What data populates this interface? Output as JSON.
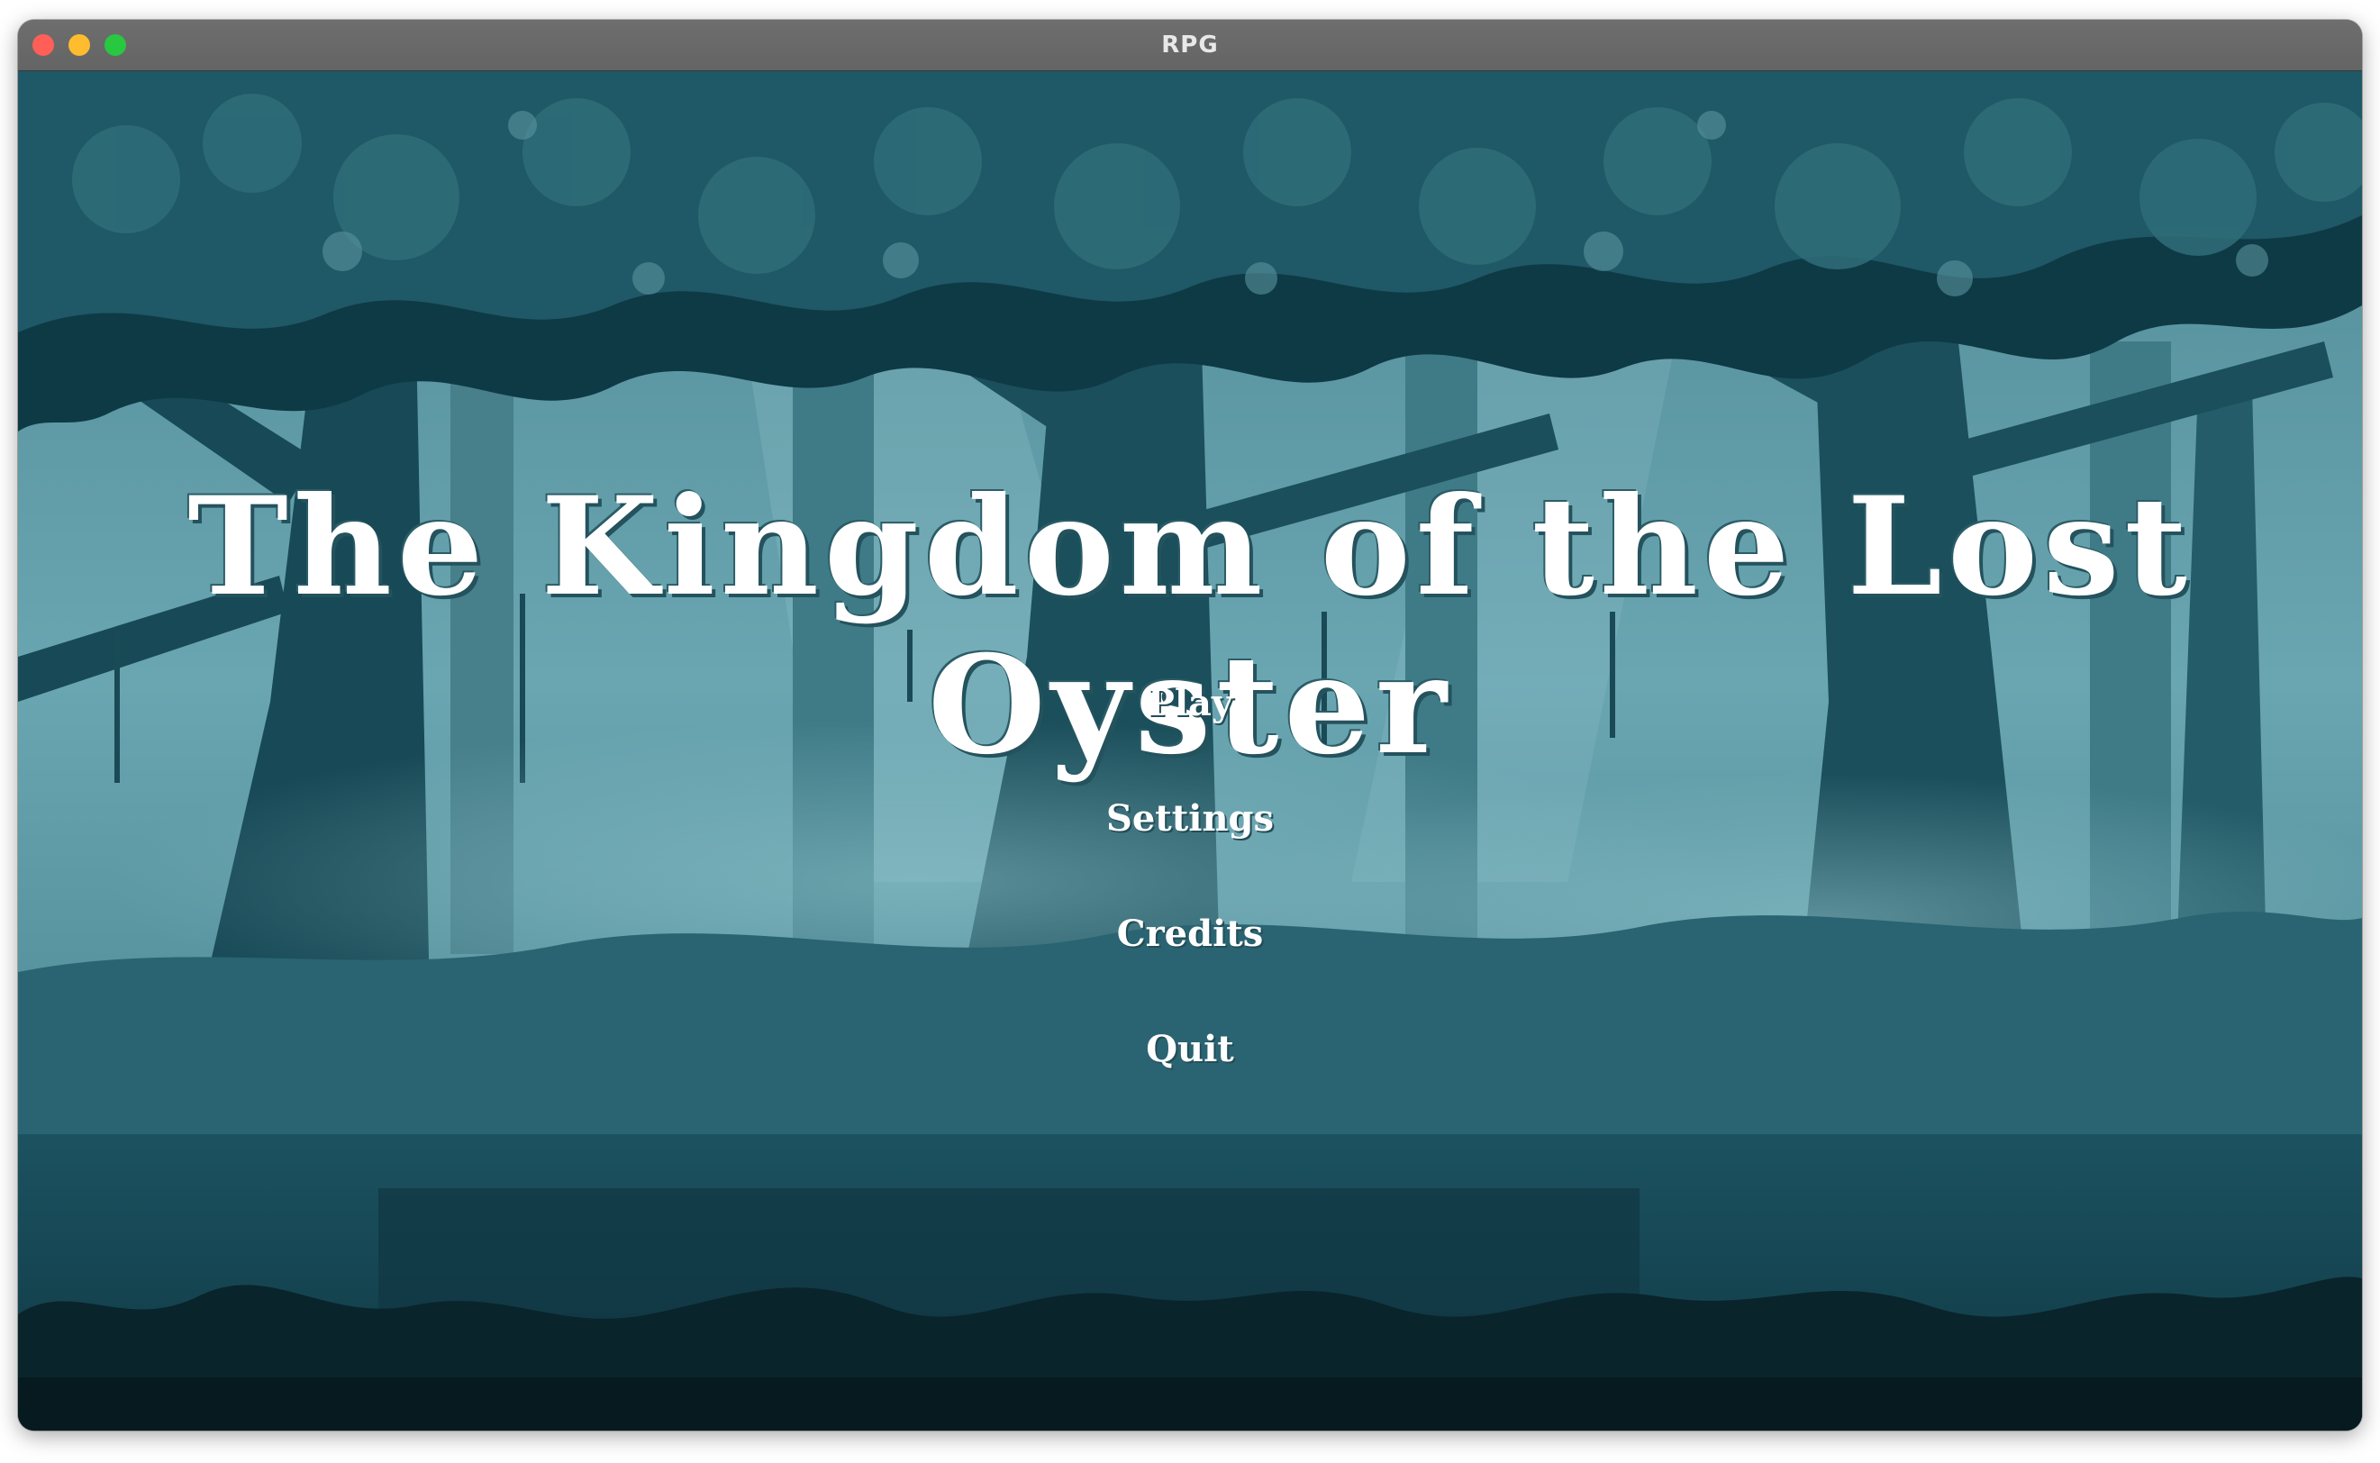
{
  "window": {
    "title": "RPG"
  },
  "game": {
    "title": "The Kingdom of the Lost Oyster",
    "menu": {
      "play": "Play",
      "settings": "Settings",
      "credits": "Credits",
      "quit": "Quit"
    }
  },
  "colors": {
    "sky": "#5f9ba6",
    "trunk": "#174a56",
    "foliage_dark": "#0e3a45",
    "foliage_mid": "#2f6d79",
    "ground": "#143f4a",
    "bushes": "#081d24",
    "text": "#ffffff"
  }
}
